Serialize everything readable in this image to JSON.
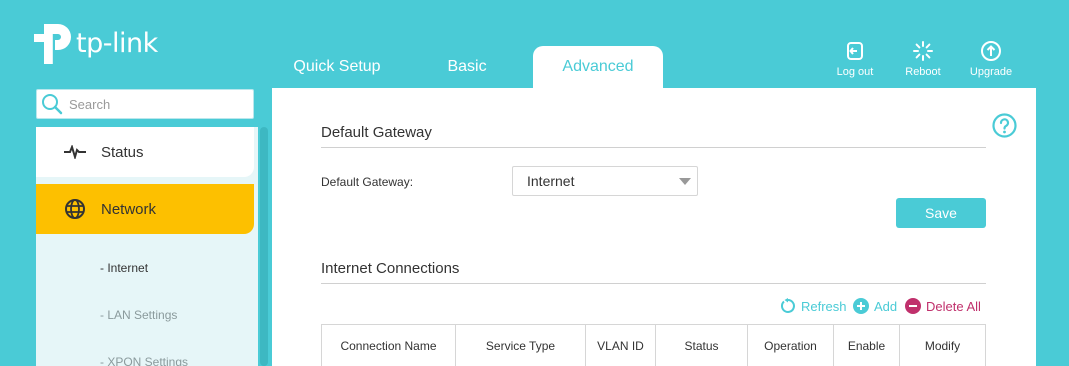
{
  "brand": {
    "name": "tp-link"
  },
  "nav": {
    "tabs": [
      {
        "label": "Quick Setup"
      },
      {
        "label": "Basic"
      },
      {
        "label": "Advanced",
        "active": true
      }
    ]
  },
  "header_actions": {
    "logout": {
      "label": "Log out",
      "icon": "logout-icon"
    },
    "reboot": {
      "label": "Reboot",
      "icon": "reboot-icon"
    },
    "upgrade": {
      "label": "Upgrade",
      "icon": "upgrade-icon"
    }
  },
  "sidebar": {
    "search": {
      "placeholder": "Search"
    },
    "items": [
      {
        "label": "Status",
        "icon": "pulse-icon"
      },
      {
        "label": "Network",
        "icon": "globe-icon",
        "active": true
      }
    ],
    "subitems": [
      {
        "label": "- Internet",
        "active": true
      },
      {
        "label": "- LAN Settings"
      },
      {
        "label": "- XPON Settings"
      }
    ]
  },
  "main": {
    "default_gateway_section": {
      "title": "Default Gateway",
      "field_label": "Default Gateway:",
      "selected_value": "Internet",
      "save_label": "Save"
    },
    "internet_connections_section": {
      "title": "Internet Connections",
      "toolbar": {
        "refresh_label": "Refresh",
        "add_label": "Add",
        "delete_all_label": "Delete All"
      },
      "table": {
        "columns": [
          "Connection Name",
          "Service Type",
          "VLAN ID",
          "Status",
          "Operation",
          "Enable",
          "Modify"
        ]
      }
    }
  },
  "colors": {
    "brand": "#4acbd6",
    "active_item": "#fdc000",
    "delete": "#c0306c"
  }
}
